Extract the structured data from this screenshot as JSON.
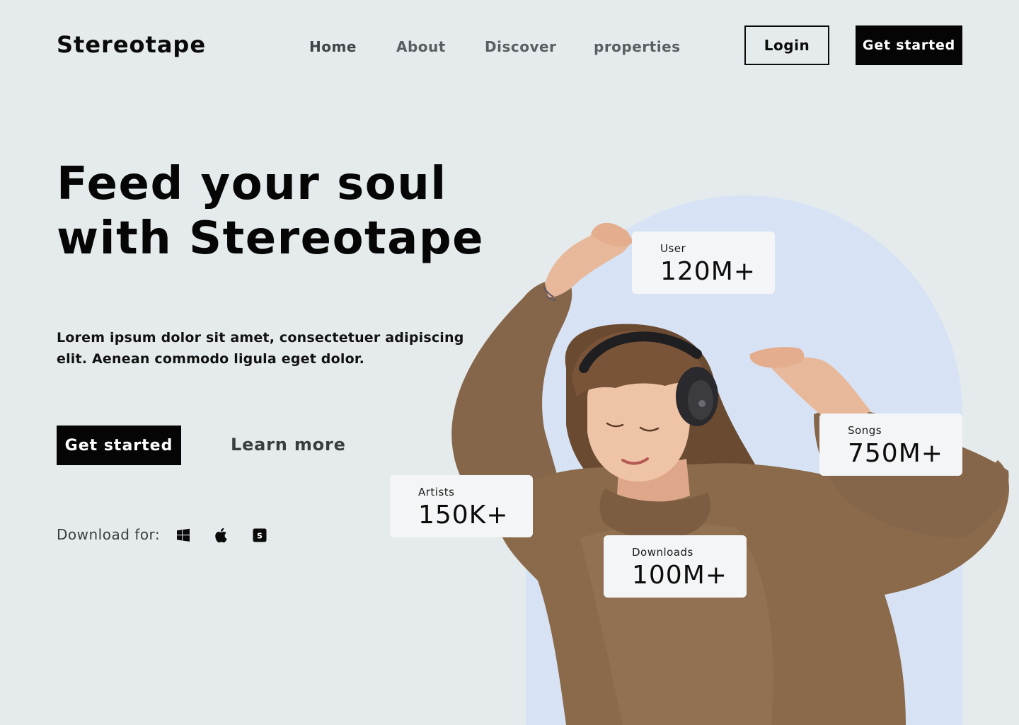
{
  "brand": {
    "name": "Stereotape"
  },
  "nav": {
    "items": [
      {
        "label": "Home"
      },
      {
        "label": "About"
      },
      {
        "label": "Discover"
      },
      {
        "label": "properties"
      }
    ]
  },
  "header": {
    "login_label": "Login",
    "get_started_label": "Get started"
  },
  "hero": {
    "title_line1": "Feed your soul",
    "title_line2": "with Stereotape",
    "description": "Lorem ipsum dolor sit amet, consectetuer adipiscing elit. Aenean commodo ligula eget dolor.",
    "primary_cta": "Get started",
    "secondary_cta": "Learn more",
    "download_label": "Download for:",
    "platforms": [
      {
        "icon": "windows-icon"
      },
      {
        "icon": "apple-icon"
      },
      {
        "icon": "store-icon"
      }
    ]
  },
  "stats": {
    "users": {
      "label": "User",
      "value": "120M+"
    },
    "songs": {
      "label": "Songs",
      "value": "750M+"
    },
    "artists": {
      "label": "Artists",
      "value": "150K+"
    },
    "downloads": {
      "label": "Downloads",
      "value": "100M+"
    }
  },
  "colors": {
    "page_background": "#e5ebec",
    "primary": "#050505",
    "arch": "#d7e3f5",
    "card": "#f4f5f6",
    "sweater": "#8a6a4a"
  }
}
